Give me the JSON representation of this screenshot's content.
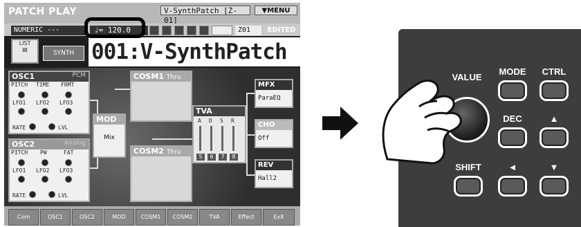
{
  "screen": {
    "title": "PATCH PLAY",
    "patch_header": "V-SynthPatch [Z-01]",
    "menu_label": "MENU",
    "numeric_label": "NUMERIC ---",
    "tempo_value": "120.0",
    "patch_bank": "Z01",
    "edited_badge": "EDITED",
    "list_button": "LIST",
    "synth_button": "SYNTH",
    "patch_name": "001:V-SynthPatch"
  },
  "osc1": {
    "title": "OSC1",
    "type": "PCM",
    "params": [
      "PITCH",
      "TIME",
      "FRMT"
    ],
    "lfo": [
      "LFO1",
      "LFO2",
      "LFO3"
    ],
    "rate": "RATE",
    "lvl": "LVL"
  },
  "osc2": {
    "title": "OSC2",
    "type": "Analog",
    "params": [
      "PITCH",
      "PW",
      "FAT"
    ],
    "lfo": [
      "LFO1",
      "LFO2",
      "LFO3"
    ],
    "rate": "RATE",
    "lvl": "LVL"
  },
  "mod": {
    "title": "MOD",
    "value": "Mix"
  },
  "cosm1": {
    "title": "COSM1",
    "mode": "Thru"
  },
  "cosm2": {
    "title": "COSM2",
    "mode": "Thru"
  },
  "tva": {
    "title": "TVA",
    "sliders": [
      "A",
      "D",
      "S",
      "R"
    ],
    "numbers": [
      "5",
      "6",
      "7",
      "8"
    ]
  },
  "effects": {
    "mfx": {
      "title": "MFX",
      "value": "ParaEQ"
    },
    "cho": {
      "title": "CHO",
      "value": "Off"
    },
    "rev": {
      "title": "REV",
      "value": "Hall2"
    }
  },
  "tabs": [
    "Com",
    "OSC1",
    "OSC2",
    "MOD",
    "COSM1",
    "COSM2",
    "TVA",
    "Effect",
    "Exit"
  ],
  "hardware": {
    "value_label": "VALUE",
    "mode_label": "MODE",
    "ctrl_label": "CTRL",
    "dec_label": "DEC",
    "up_label": "▲",
    "shift_label": "SHIFT",
    "left_label": "◄",
    "down_label": "▼"
  }
}
